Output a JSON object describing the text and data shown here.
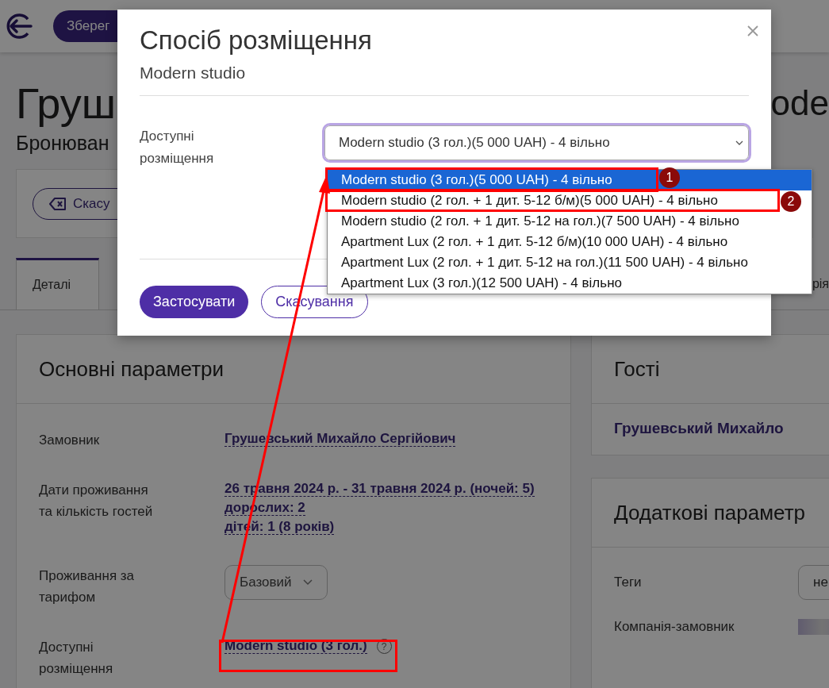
{
  "topbar": {
    "save_button": "Зберег"
  },
  "header": {
    "title_start": "Груш",
    "title_end": "ode",
    "subtitle": "Бронюван"
  },
  "actions": {
    "cancel_button": "Скасу"
  },
  "tabs": [
    {
      "label": "Деталі",
      "selected": true
    },
    {
      "label": "рія",
      "selected": false
    }
  ],
  "main_card": {
    "title": "Основні параметри",
    "rows": [
      {
        "label": [
          "Замовник"
        ],
        "kind": "links",
        "values": [
          "Грушевський Михайло Сергійович"
        ]
      },
      {
        "label": [
          "Дати проживання",
          "та кількість гостей"
        ],
        "kind": "links",
        "values": [
          "26 травня 2024 р. - 31 травня 2024 р. (ночей: 5)",
          "дорослих: 2",
          "дітей: 1 (8 років)"
        ]
      },
      {
        "label": [
          "Проживання за",
          "тарифом"
        ],
        "kind": "select",
        "value": "Базовий"
      },
      {
        "label": [
          "Доступні",
          "розміщення"
        ],
        "kind": "link_help",
        "values": [
          "Modern studio (3 гол.)"
        ],
        "help": "?"
      }
    ]
  },
  "guests_card": {
    "title": "Гості",
    "guest": "Грушевський Михайло"
  },
  "extra_card": {
    "title": "Додаткові параметр",
    "rows": [
      {
        "label": "Теги",
        "kind": "select",
        "value": "не"
      },
      {
        "label": "Компанія-замовник",
        "kind": "blurred"
      }
    ]
  },
  "modal": {
    "title": "Спосіб розміщення",
    "subtitle": "Modern studio",
    "field_label": [
      "Доступні",
      "розміщення"
    ],
    "select_value": "Modern studio (3 гол.)(5 000 UAH) - 4 вільно",
    "options": [
      {
        "label": "Modern studio (3 гол.)(5 000 UAH) - 4 вільно",
        "selected": true
      },
      {
        "label": "Modern studio (2 гол. + 1 дит. 5-12 б/м)(5 000 UAH) - 4 вільно",
        "selected": false
      },
      {
        "label": "Modern studio (2 гол. + 1 дит. 5-12 на гол.)(7 500 UAH) - 4 вільно",
        "selected": false
      },
      {
        "label": "Apartment Lux (2 гол. + 1 дит. 5-12 б/м)(10 000 UAH) - 4 вільно",
        "selected": false
      },
      {
        "label": "Apartment Lux (2 гол. + 1 дит. 5-12 на гол.)(11 500 UAH) - 4 вільно",
        "selected": false
      },
      {
        "label": "Apartment Lux (3 гол.)(12 500 UAH) - 4 вільно",
        "selected": false
      }
    ],
    "buttons": [
      {
        "label": "Застосувати",
        "kind": "primary"
      },
      {
        "label": "Скасування",
        "kind": "secondary"
      }
    ]
  },
  "annotations": [
    {
      "number": "1"
    },
    {
      "number": "2"
    }
  ]
}
